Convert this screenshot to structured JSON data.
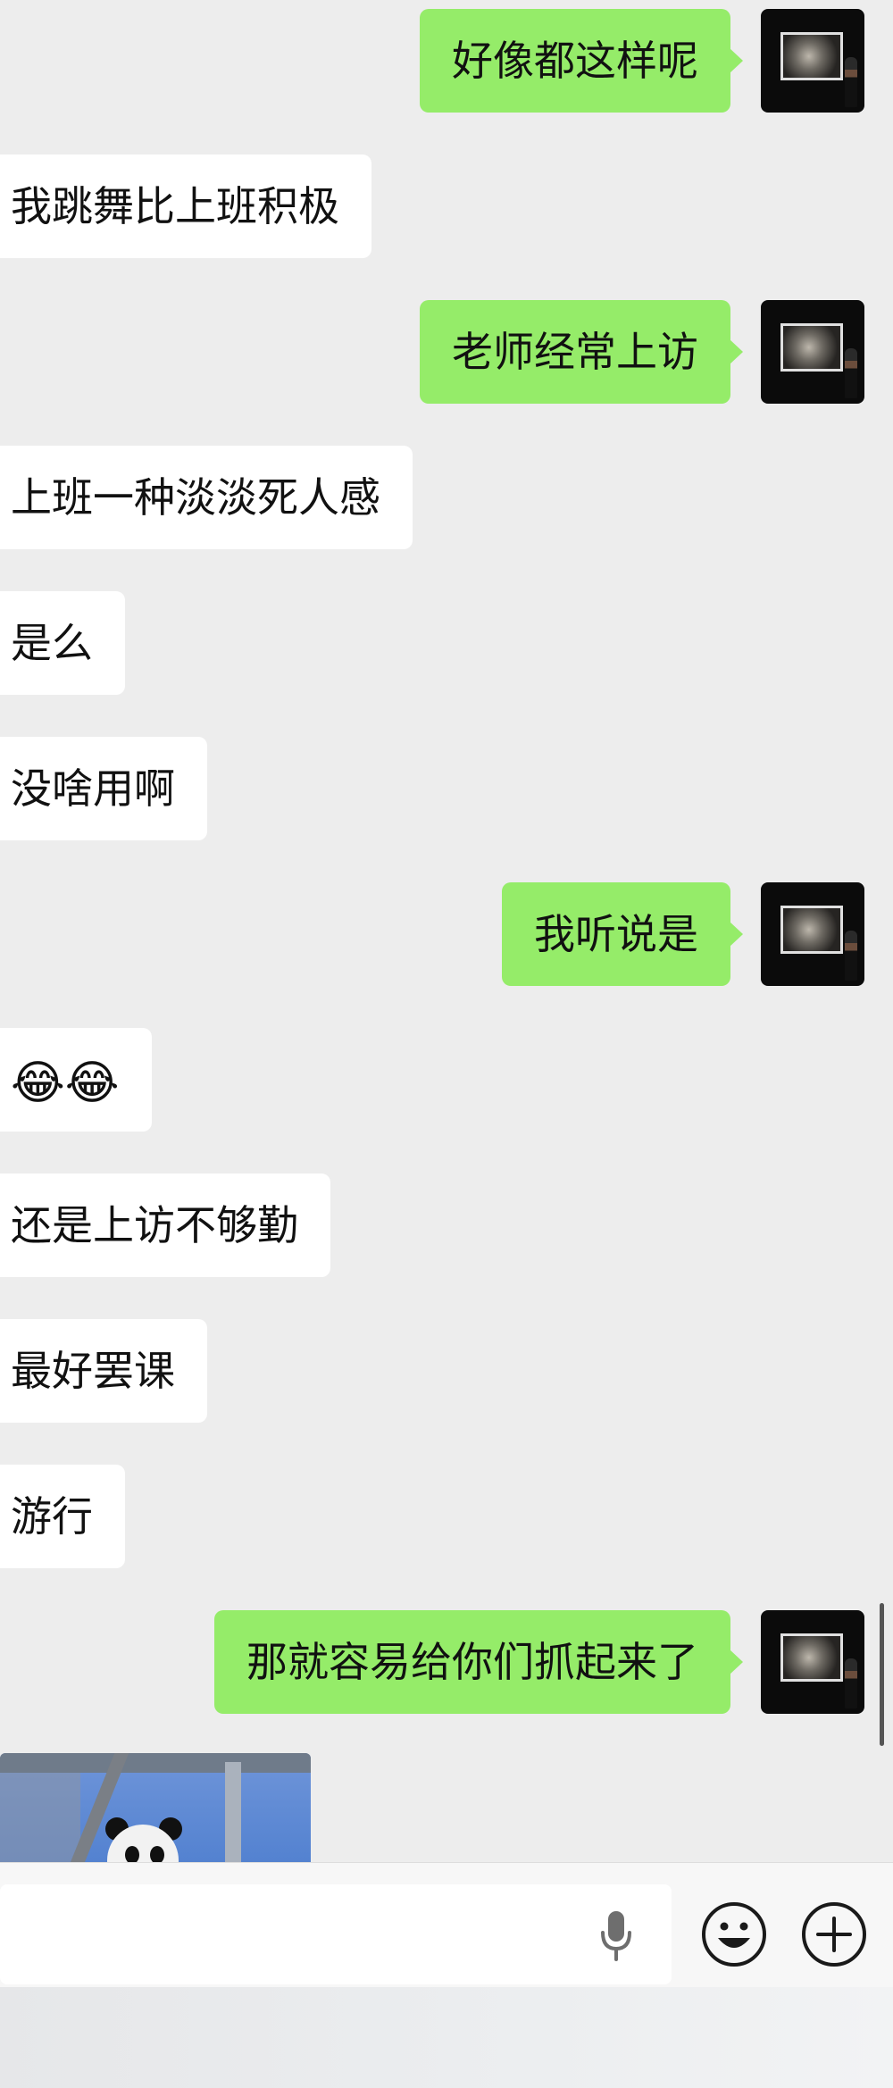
{
  "messages": [
    {
      "side": "out",
      "text": "好像都这样呢"
    },
    {
      "side": "in",
      "text": "我跳舞比上班积极"
    },
    {
      "side": "out",
      "text": "老师经常上访"
    },
    {
      "side": "in",
      "text": "上班一种淡淡死人感"
    },
    {
      "side": "in",
      "text": "是么"
    },
    {
      "side": "in",
      "text": "没啥用啊"
    },
    {
      "side": "out",
      "text": "我听说是"
    },
    {
      "side": "in",
      "text": "😂😂"
    },
    {
      "side": "in",
      "text": "还是上访不够勤"
    },
    {
      "side": "in",
      "text": "最好罢课"
    },
    {
      "side": "in",
      "text": "游行"
    },
    {
      "side": "out",
      "text": "那就容易给你们抓起来了"
    }
  ],
  "image_message": {
    "subject": "panda-photo"
  },
  "input_bar": {
    "value": "",
    "voice_icon": "microphone-icon",
    "emoji_icon": "smiley-icon",
    "more_icon": "plus-circle-icon"
  },
  "colors": {
    "background": "#ededed",
    "outgoing_bubble": "#95ec69",
    "incoming_bubble": "#ffffff"
  }
}
